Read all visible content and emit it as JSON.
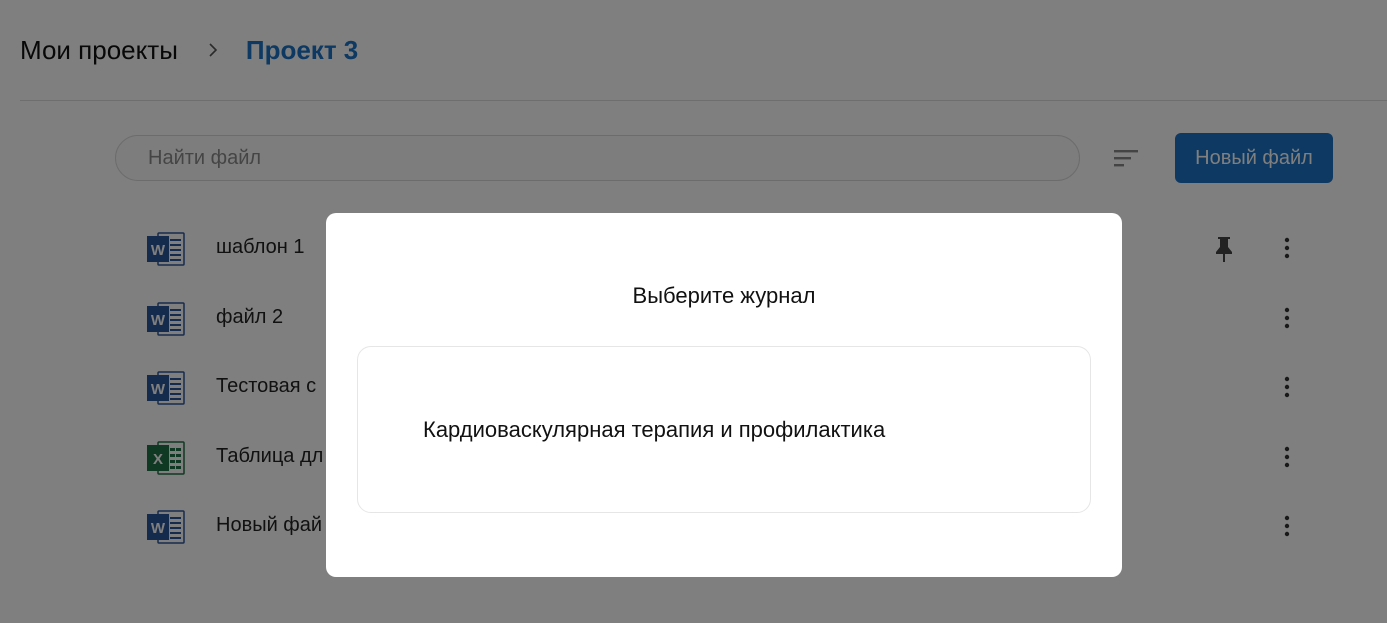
{
  "breadcrumb": {
    "root": "Мои проекты",
    "current": "Проект 3"
  },
  "toolbar": {
    "search_placeholder": "Найти файл",
    "new_file_label": "Новый файл"
  },
  "files": [
    {
      "name": "шаблон 1",
      "type": "word",
      "pinned": true
    },
    {
      "name": "файл 2",
      "type": "word",
      "pinned": false
    },
    {
      "name": "Тестовая с",
      "type": "word",
      "pinned": false
    },
    {
      "name": "Таблица дл",
      "type": "excel",
      "pinned": false
    },
    {
      "name": "Новый фай",
      "type": "word",
      "pinned": false
    }
  ],
  "modal": {
    "title": "Выберите журнал",
    "options": [
      "Кардиоваскулярная терапия и профилактика"
    ]
  },
  "colors": {
    "accent": "#1a73c4",
    "word": "#2b579a",
    "excel": "#217346",
    "overlay": "rgba(0,0,0,0.5)"
  }
}
